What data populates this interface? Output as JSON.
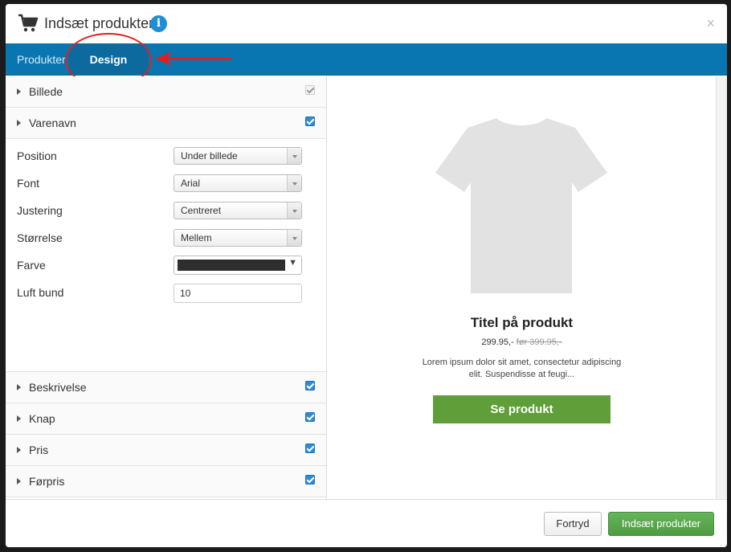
{
  "dialog": {
    "title": "Indsæt produkter",
    "info_icon": "info-icon",
    "info_glyph": "i",
    "close_glyph": "×"
  },
  "tabs": [
    {
      "label": "Produkter",
      "active": false
    },
    {
      "label": "Design",
      "active": true
    }
  ],
  "sections_top": [
    {
      "label": "Billede",
      "checked": true,
      "disabled": true
    },
    {
      "label": "Varenavn",
      "checked": true,
      "disabled": false
    }
  ],
  "settings": {
    "position": {
      "label": "Position",
      "value": "Under billede"
    },
    "font": {
      "label": "Font",
      "value": "Arial"
    },
    "justering": {
      "label": "Justering",
      "value": "Centreret"
    },
    "storrelse": {
      "label": "Størrelse",
      "value": "Mellem"
    },
    "farve": {
      "label": "Farve",
      "value": "#2e2e2e"
    },
    "luft_bund": {
      "label": "Luft bund",
      "value": "10"
    }
  },
  "sections_bottom": [
    {
      "label": "Beskrivelse",
      "checked": true
    },
    {
      "label": "Knap",
      "checked": true
    },
    {
      "label": "Pris",
      "checked": true
    },
    {
      "label": "Førpris",
      "checked": true
    }
  ],
  "preview": {
    "image_icon": "tshirt-icon",
    "title": "Titel på produkt",
    "price": "299.95,-",
    "old_price": "før 399.95,-",
    "description": "Lorem ipsum dolor sit amet, consectetur adipiscing elit. Suspendisse at feugi...",
    "button_label": "Se produkt"
  },
  "footer": {
    "cancel_label": "Fortryd",
    "insert_label": "Indsæt produkter"
  },
  "colors": {
    "tabbar": "#0a76b1",
    "primary_button": "#5cb85c",
    "preview_button": "#5f9e38",
    "annotation": "#e02020"
  }
}
